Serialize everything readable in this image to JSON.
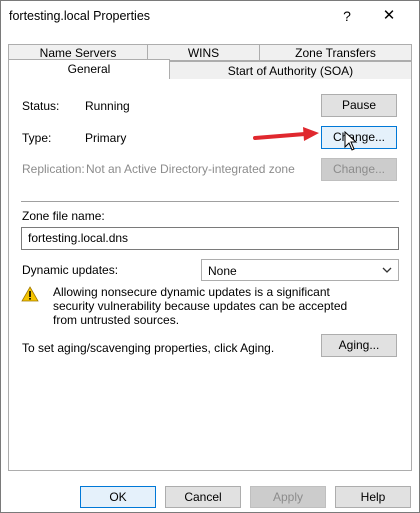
{
  "window": {
    "title": "fortesting.local Properties",
    "help_glyph": "?",
    "close_glyph": "✕"
  },
  "tabs": {
    "row1": [
      "Name Servers",
      "WINS",
      "Zone Transfers"
    ],
    "row2": [
      "General",
      "Start of Authority (SOA)"
    ],
    "active": "General"
  },
  "general": {
    "status_label": "Status:",
    "status_value": "Running",
    "pause_button": "Pause",
    "type_label": "Type:",
    "type_value": "Primary",
    "change_type_button": "Change...",
    "replication_label": "Replication:",
    "replication_value": "Not an Active Directory-integrated zone",
    "change_replication_button": "Change...",
    "zone_file_label": "Zone file name:",
    "zone_file_value": "fortesting.local.dns",
    "dynamic_updates_label": "Dynamic updates:",
    "dynamic_updates_value": "None",
    "warning_text": "Allowing nonsecure dynamic updates is a significant security vulnerability because updates can be accepted from untrusted sources.",
    "aging_text": "To set aging/scavenging properties, click Aging.",
    "aging_button": "Aging..."
  },
  "footer": {
    "ok": "OK",
    "cancel": "Cancel",
    "apply": "Apply",
    "help": "Help"
  },
  "colors": {
    "annotation_arrow": "#e0282e",
    "warning_yellow": "#f5c400",
    "focus_blue": "#0078d7"
  },
  "icons": {
    "warning": "warning-triangle-icon",
    "dropdown": "chevron-down-icon",
    "cursor": "mouse-pointer-icon"
  }
}
